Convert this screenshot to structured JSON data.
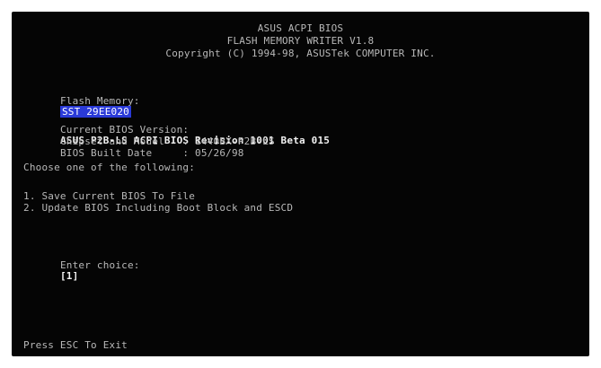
{
  "header": {
    "line1": "ASUS ACPI BIOS",
    "line2": "FLASH MEMORY WRITER V1.8",
    "line3": "Copyright (C) 1994-98, ASUSTek COMPUTER INC."
  },
  "flash": {
    "label": "Flash Memory:",
    "value": "SST 29EE020"
  },
  "info": {
    "bios_label": "Current BIOS Version:",
    "bios_value": "ASUS P2B-LS ACPI BIOS Revision 1001 Beta 015",
    "chipset_label": "Chipset and Model",
    "chipset_value": ": i440BX-P2B-LS",
    "date_label": "BIOS Built Date",
    "date_value": ": 05/26/98"
  },
  "menu": {
    "prompt": "Choose one of the following:",
    "options": [
      "1. Save Current BIOS To File",
      "2. Update BIOS Including Boot Block and ESCD"
    ]
  },
  "choice": {
    "label": "Enter choice:",
    "value": "[1]"
  },
  "footer": {
    "esc_text": "Press ESC To Exit"
  },
  "colors": {
    "background": "#050505",
    "text": "#b8b8b8",
    "highlight": "#2a3ad8"
  }
}
